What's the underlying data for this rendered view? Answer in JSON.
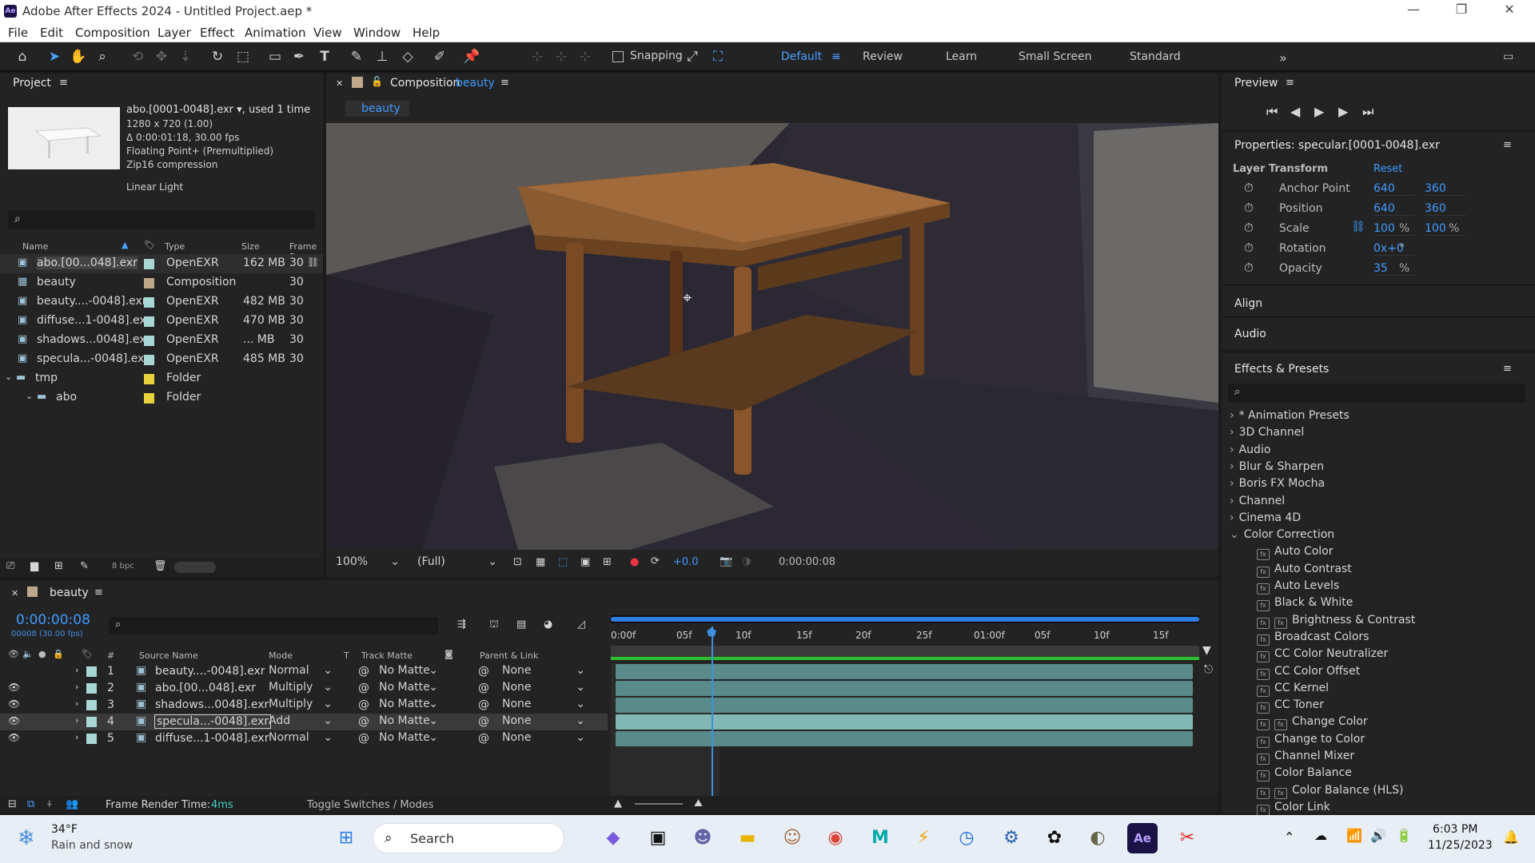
{
  "window": {
    "title": "Adobe After Effects 2024 - Untitled Project.aep *",
    "app_icon": "Ae",
    "controls": [
      "minimize-icon",
      "restore-icon",
      "close-icon"
    ]
  },
  "menu": [
    "File",
    "Edit",
    "Composition",
    "Layer",
    "Effect",
    "Animation",
    "View",
    "Window",
    "Help"
  ],
  "toolbar": {
    "snapping_label": "Snapping",
    "workspaces": [
      "Default",
      "Review",
      "Learn",
      "Small Screen",
      "Standard"
    ],
    "active_workspace": "Default"
  },
  "project": {
    "title": "Project",
    "selected": {
      "name": "abo.[0001-0048].exr",
      "used": ", used 1 time",
      "dims": "1280 x 720 (1.00)",
      "duration": "Δ 0:00:01:18, 30.00 fps",
      "depth": "Floating Point+ (Premultiplied)",
      "compression": "Zip16 compression",
      "light": "Linear Light"
    },
    "columns": [
      "Name",
      "Type",
      "Size",
      "Frame R"
    ],
    "items": [
      {
        "name": "abo.[00...048].exr",
        "type": "OpenEXR",
        "size": "162 MB",
        "fr": "30",
        "color": "#a9d7d6",
        "kind": "footage"
      },
      {
        "name": "beauty",
        "type": "Composition",
        "size": "",
        "fr": "30",
        "color": "#bfa78a",
        "kind": "comp"
      },
      {
        "name": "beauty....-0048].exr",
        "type": "OpenEXR",
        "size": "482 MB",
        "fr": "30",
        "color": "#a9d7d6",
        "kind": "footage"
      },
      {
        "name": "diffuse...1-0048].exr",
        "type": "OpenEXR",
        "size": "470 MB",
        "fr": "30",
        "color": "#a9d7d6",
        "kind": "footage"
      },
      {
        "name": "shadows...0048].exr",
        "type": "OpenEXR",
        "size": "... MB",
        "fr": "30",
        "color": "#a9d7d6",
        "kind": "footage"
      },
      {
        "name": "specula...-0048].exr",
        "type": "OpenEXR",
        "size": "485 MB",
        "fr": "30",
        "color": "#a9d7d6",
        "kind": "footage"
      },
      {
        "name": "tmp",
        "type": "Folder",
        "size": "",
        "fr": "",
        "color": "#e8d23c",
        "kind": "folder"
      },
      {
        "name": "abo",
        "type": "Folder",
        "size": "",
        "fr": "",
        "color": "#e8d23c",
        "kind": "folder"
      }
    ],
    "bpc": "8 bpc"
  },
  "composition": {
    "label": "Composition",
    "name": "beauty",
    "tab": "beauty",
    "zoom": "100%",
    "resolution": "(Full)",
    "exposure": "+0.0",
    "timecode": "0:00:00:08"
  },
  "preview": {
    "title": "Preview"
  },
  "properties": {
    "title": "Properties: specular.[0001-0048].exr",
    "section": "Layer Transform",
    "reset": "Reset",
    "rows": [
      {
        "name": "Anchor Point",
        "v1": "640",
        "v2": "360"
      },
      {
        "name": "Position",
        "v1": "640",
        "v2": "360"
      },
      {
        "name": "Scale",
        "v1": "100",
        "u1": "%",
        "v2": "100",
        "u2": "%"
      },
      {
        "name": "Rotation",
        "v1": "0x+0",
        "u1": "°",
        "v2": "",
        "u2": ""
      },
      {
        "name": "Opacity",
        "v1": "35",
        "u1": "%",
        "v2": "",
        "u2": ""
      }
    ],
    "align": "Align",
    "audio": "Audio"
  },
  "effects": {
    "title": "Effects & Presets",
    "categories": [
      "* Animation Presets",
      "3D Channel",
      "Audio",
      "Blur & Sharpen",
      "Boris FX Mocha",
      "Channel",
      "Cinema 4D",
      "Color Correction"
    ],
    "items": [
      "Auto Color",
      "Auto Contrast",
      "Auto Levels",
      "Black & White",
      "Brightness & Contrast",
      "Broadcast Colors",
      "CC Color Neutralizer",
      "CC Color Offset",
      "CC Kernel",
      "CC Toner",
      "Change Color",
      "Change to Color",
      "Channel Mixer",
      "Color Balance",
      "Color Balance (HLS)",
      "Color Link"
    ],
    "gpu_items": [
      "Brightness & Contrast",
      "Change Color",
      "Color Balance (HLS)"
    ]
  },
  "timeline": {
    "comp": "beauty",
    "timecode": "0:00:00:08",
    "frames": "00008 (30.00 fps)",
    "columns": [
      "#",
      "Source Name",
      "Mode",
      "T",
      "Track Matte",
      "Parent & Link"
    ],
    "ruler": [
      "0:00f",
      "05f",
      "10f",
      "15f",
      "20f",
      "25f",
      "01:00f",
      "05f",
      "10f",
      "15f"
    ],
    "layers": [
      {
        "num": "1",
        "name": "beauty....-0048].exr",
        "mode": "Normal",
        "matte": "No Matte",
        "parent": "None",
        "visible": false
      },
      {
        "num": "2",
        "name": "abo.[00...048].exr",
        "mode": "Multiply",
        "matte": "No Matte",
        "parent": "None",
        "visible": true
      },
      {
        "num": "3",
        "name": "shadows...0048].exr",
        "mode": "Multiply",
        "matte": "No Matte",
        "parent": "None",
        "visible": true
      },
      {
        "num": "4",
        "name": "specula...-0048].exr",
        "mode": "Add",
        "matte": "No Matte",
        "parent": "None",
        "visible": true
      },
      {
        "num": "5",
        "name": "diffuse...1-0048].exr",
        "mode": "Normal",
        "matte": "No Matte",
        "parent": "None",
        "visible": true
      }
    ],
    "render_label": "Frame Render Time:",
    "render_time": "4ms",
    "toggle": "Toggle Switches / Modes"
  },
  "taskbar": {
    "temp": "34°F",
    "weather": "Rain and snow",
    "search": "Search",
    "time": "6:03 PM",
    "date": "11/25/2023"
  }
}
